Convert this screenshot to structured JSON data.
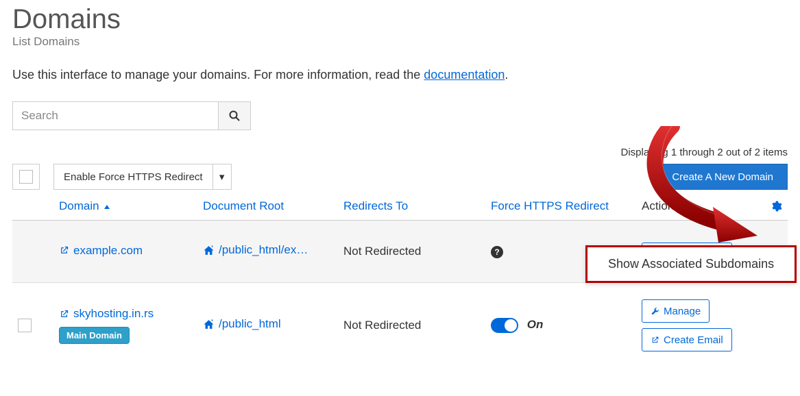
{
  "header": {
    "title": "Domains",
    "subtitle": "List Domains",
    "intro_prefix": "Use this interface to manage your domains. For more information, read the ",
    "doc_link_text": "documentation",
    "intro_suffix": "."
  },
  "search": {
    "placeholder": "Search"
  },
  "toolbar": {
    "force_https_label": "Enable Force HTTPS Redirect",
    "status_text": "Displaying 1 through 2 out of 2 items",
    "create_domain_label": "Create A New Domain"
  },
  "columns": {
    "domain": "Domain",
    "document_root": "Document Root",
    "redirects_to": "Redirects To",
    "force_https": "Force HTTPS Redirect",
    "actions": "Actions"
  },
  "rows": [
    {
      "domain": "example.com",
      "document_root": "/public_html/ex…",
      "redirects_to": "Not Redirected",
      "force_https_mode": "unknown",
      "main_domain": false
    },
    {
      "domain": "skyhosting.in.rs",
      "document_root": "/public_html",
      "redirects_to": "Not Redirected",
      "force_https_mode": "on",
      "force_https_label": "On",
      "main_domain": true,
      "badge_label": "Main Domain"
    }
  ],
  "actions": {
    "manage": "Manage",
    "create_email": "Create Email"
  },
  "popup": {
    "label": "Show Associated Subdomains"
  },
  "icons": {
    "sort_asc": "▲",
    "caret_down": "▾",
    "question": "?"
  }
}
